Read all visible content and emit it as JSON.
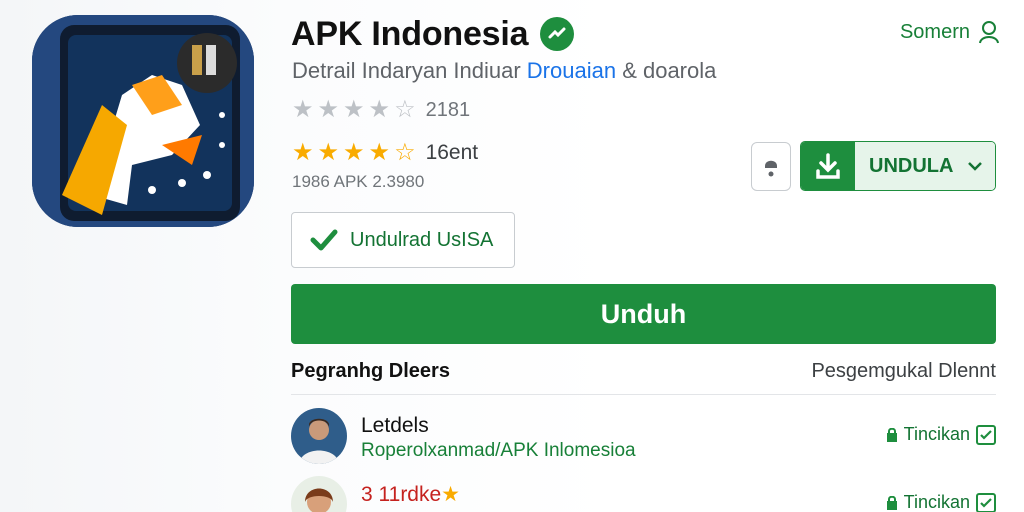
{
  "app": {
    "title": "APK Indonesia",
    "subtitle_text": "Detrail Indaryan Indiuar ",
    "subtitle_link": "Drouaian",
    "subtitle_tail": " & doarola",
    "rating_count_1": "2181",
    "rating_label_2": "16ent",
    "meta": "1986 APK 2.3980"
  },
  "header": {
    "signin_label": "Somern"
  },
  "buttons": {
    "download_label": "UNDULA",
    "secondary_label": "Undulrad UsISA",
    "main_label": "Unduh"
  },
  "section": {
    "left_title": "Pegranhg Dleers",
    "right_title": "Pesgemgukal Dlennt"
  },
  "rows": [
    {
      "name": "Letdels",
      "sub": "Roperolxanmad/APK Inlomesioa",
      "action": "Tincikan"
    },
    {
      "name": "3 11rdke",
      "sub": "",
      "action": "Tincikan"
    }
  ],
  "colors": {
    "accent": "#1e8e3e",
    "link": "#1a73e8",
    "star": "#f9ab00"
  },
  "ratings": {
    "row1_filled": 0,
    "row2_filled": 4.5
  }
}
